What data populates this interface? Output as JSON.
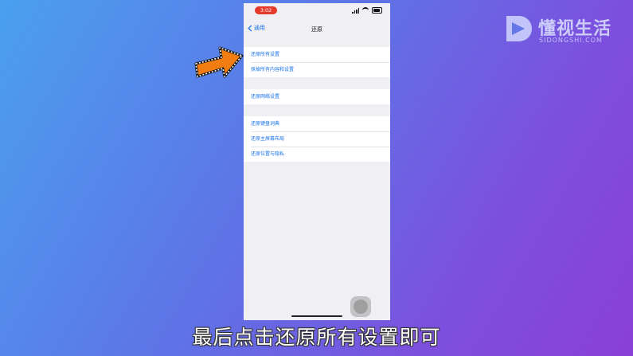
{
  "status_bar": {
    "time": "3:02"
  },
  "nav": {
    "back_label": "通用",
    "title": "还原"
  },
  "groups": [
    {
      "items": [
        "还原所有设置",
        "抹掉所有内容和设置"
      ]
    },
    {
      "items": [
        "还原网络设置"
      ]
    },
    {
      "items": [
        "还原键盘词典",
        "还原主屏幕布局",
        "还原位置与隐私"
      ]
    }
  ],
  "watermark": {
    "brand_cn": "懂视生活",
    "brand_en": "SIDONGSHI.COM"
  },
  "caption": "最后点击还原所有设置即可",
  "colors": {
    "accent": "#1a73e8",
    "arrow": "#f07c12",
    "time_pill": "#e5392b"
  }
}
